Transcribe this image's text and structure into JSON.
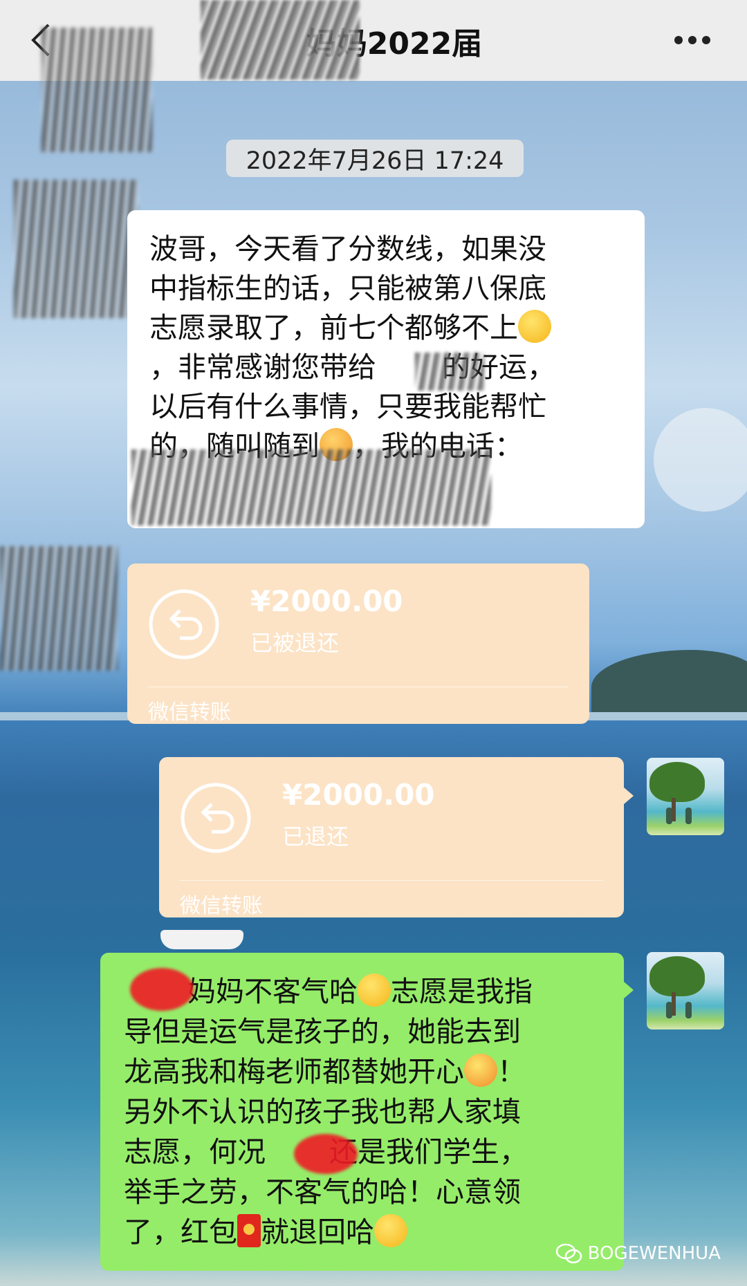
{
  "header": {
    "title": "妈妈2022届"
  },
  "timestamp": "2022年7月26日 17:24",
  "incoming_message": {
    "lines": [
      "波哥，今天看了分数线，如果没",
      "中指标生的话，只能被第八保底",
      "志愿录取了，前七个都够不上",
      "，非常感谢您带给",
      "的好运，",
      "以后有什么事情，只要我能帮忙",
      "的，随叫随到",
      "，我的电话："
    ]
  },
  "transfers": [
    {
      "amount": "¥2000.00",
      "status": "已被退还",
      "label": "微信转账"
    },
    {
      "amount": "¥2000.00",
      "status": "已退还",
      "label": "微信转账"
    }
  ],
  "outgoing_message": {
    "lines": [
      "妈妈不客气哈",
      "志愿是我指",
      "导但是运气是孩子的，她能去到",
      "龙高我和梅老师都替她开心",
      "！",
      "另外不认识的孩子我也帮人家填",
      "志愿，何况",
      "还是我们学生，",
      "举手之劳，不客气的哈！心意领",
      "了，红包",
      "就退回哈"
    ]
  },
  "watermark": "BOGEWENHUA",
  "icons": {
    "back": "chevron-left-icon",
    "more": "more-dots-icon",
    "transfer": "return-arrow-icon",
    "emojis": [
      "sweat-emoji-icon",
      "angry-headband-emoji-icon",
      "grin-emoji-icon",
      "party-emoji-icon",
      "red-envelope-icon",
      "grin-emoji-icon"
    ]
  },
  "colors": {
    "topbar": "#ededed",
    "incoming_bubble": "#ffffff",
    "outgoing_bubble": "#95ec69",
    "transfer_bubble": "#fce3c6",
    "redaction": "#ee1c25"
  }
}
